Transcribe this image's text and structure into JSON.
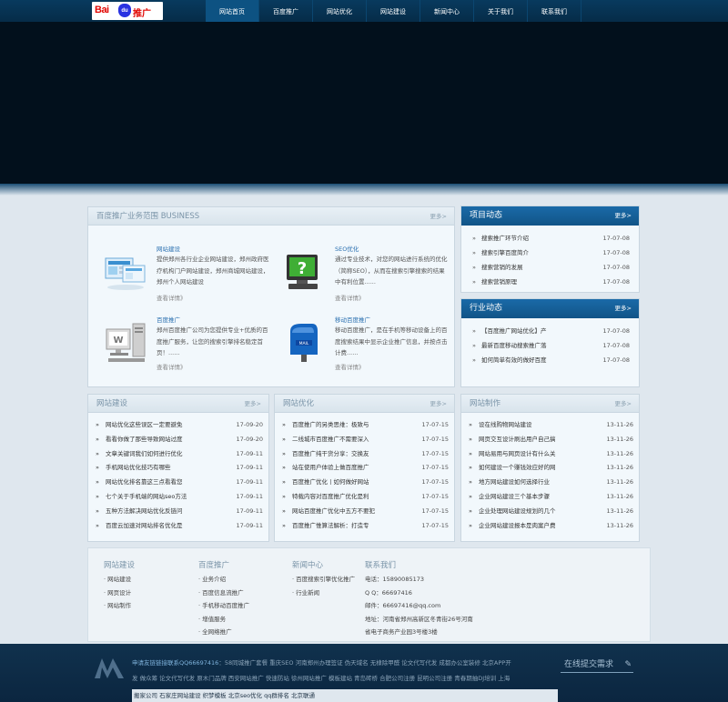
{
  "logo": {
    "bai": "Bai",
    "du": "du",
    "tg": "推广"
  },
  "nav": [
    "网站首页",
    "百度推广",
    "网站优化",
    "网站建设",
    "新闻中心",
    "关于我们",
    "联系我们"
  ],
  "business": {
    "title": "百度推广业务范围 BUSINESS",
    "more": "更多>",
    "items": [
      {
        "title": "网站建设",
        "desc": "提供郑州各行业企业网站建设，郑州政府医疗机构门户网站建设，郑州商城网站建设，郑州个人网站建设",
        "link": "查看详情》"
      },
      {
        "title": "SEO优化",
        "desc": "通过专业技术，对您的网站进行系统的优化（简称SEO），从而在搜索引擎搜索的结果中有利位置......",
        "link": "查看详情》"
      },
      {
        "title": "百度推广",
        "desc": "郑州百度推广公司为您提供专业+优质的百度推广服务，让您的搜索引擎排名稳定首页！......",
        "link": "查看详情》"
      },
      {
        "title": "移动百度推广",
        "desc": "移动百度推广，是在手机等移动设备上的百度搜索结果中显示企业推广信息，并按点击计费......",
        "link": "查看详情》"
      }
    ]
  },
  "projects": {
    "title": "项目动态",
    "more": "更多>",
    "rows": [
      {
        "b": "»",
        "t": "搜索推广环节介绍",
        "d": "17-07-08"
      },
      {
        "b": "»",
        "t": "搜索引擎百度简介",
        "d": "17-07-08"
      },
      {
        "b": "»",
        "t": "搜索营销的发展",
        "d": "17-07-08"
      },
      {
        "b": "»",
        "t": "搜索营销原理",
        "d": "17-07-08"
      }
    ]
  },
  "industry": {
    "title": "行业动态",
    "more": "更多>",
    "rows": [
      {
        "b": "»",
        "t": "【百度推广网站优化】产",
        "d": "17-07-08"
      },
      {
        "b": "»",
        "t": "最新百度移动搜索推广落",
        "d": "17-07-08"
      },
      {
        "b": "»",
        "t": "如何简单有效的做好百度",
        "d": "17-07-08"
      }
    ]
  },
  "cols": [
    {
      "title": "网站建设",
      "more": "更多>",
      "rows": [
        {
          "b": "»",
          "t": "网站优化这些误区一定要避免",
          "d": "17-09-20"
        },
        {
          "b": "»",
          "t": "看看你做了那些导致网站过度",
          "d": "17-09-20"
        },
        {
          "b": "»",
          "t": "文章关键词我们如何进行优化",
          "d": "17-09-11"
        },
        {
          "b": "»",
          "t": "手机网站优化技巧有哪些",
          "d": "17-09-11"
        },
        {
          "b": "»",
          "t": "网站优化排名靠这三点看看您",
          "d": "17-09-11"
        },
        {
          "b": "»",
          "t": "七个关于手机端的网站seo方法",
          "d": "17-09-11"
        },
        {
          "b": "»",
          "t": "五种方法解决网站优化反链问",
          "d": "17-09-11"
        },
        {
          "b": "»",
          "t": "百度云加速对网站排名优化是",
          "d": "17-09-11"
        }
      ]
    },
    {
      "title": "网站优化",
      "more": "更多>",
      "rows": [
        {
          "b": "»",
          "t": "百度推广的另类思维：极致与",
          "d": "17-07-15"
        },
        {
          "b": "»",
          "t": "二线城市百度推广不需要深入",
          "d": "17-07-15"
        },
        {
          "b": "»",
          "t": "百度推广纯干货分享：交换友",
          "d": "17-07-15"
        },
        {
          "b": "»",
          "t": "站在使用户体验上做百度推广",
          "d": "17-07-15"
        },
        {
          "b": "»",
          "t": "百度推广优化丨如何做好网站",
          "d": "17-07-15"
        },
        {
          "b": "»",
          "t": "特载内容对百度推广优化是利",
          "d": "17-07-15"
        },
        {
          "b": "»",
          "t": "网站百度推广优化中五方不要犯",
          "d": "17-07-15"
        },
        {
          "b": "»",
          "t": "百度推广惟算法解析：打造专",
          "d": "17-07-15"
        }
      ]
    },
    {
      "title": "网站制作",
      "more": "更多>",
      "rows": [
        {
          "b": "»",
          "t": "设在线购物网站建设",
          "d": "13-11-26"
        },
        {
          "b": "»",
          "t": "网页交互设计刷出用户自己搞",
          "d": "13-11-26"
        },
        {
          "b": "»",
          "t": "网站易用与网页设计有什么关",
          "d": "13-11-26"
        },
        {
          "b": "»",
          "t": "如何建设一个赚钱效应好的网",
          "d": "13-11-26"
        },
        {
          "b": "»",
          "t": "地方网站建设如何选择行业",
          "d": "13-11-26"
        },
        {
          "b": "»",
          "t": "企业网站建设三个基本步骤",
          "d": "13-11-26"
        },
        {
          "b": "»",
          "t": "企业处理网站建设规划的几个",
          "d": "13-11-26"
        },
        {
          "b": "»",
          "t": "企业网站建设报本是肉案户费",
          "d": "13-11-26"
        }
      ]
    }
  ],
  "footnav": [
    {
      "title": "网站建设",
      "items": [
        "· 网站建设",
        "· 网页设计",
        "· 网站制作"
      ]
    },
    {
      "title": "百度推广",
      "items": [
        "· 业务介绍",
        "· 百度信息流推广",
        "· 手机移动百度推广",
        "· 增值服务",
        "· 全网络推广"
      ]
    },
    {
      "title": "新闻中心",
      "items": [
        "· 百度搜索引擎优化推广",
        "· 行业新闻"
      ]
    },
    {
      "title": "联系我们",
      "items": [
        "电话：15890085173",
        "Q Q：66697416",
        "邮件：66697416@qq.com",
        "地址：河南省郑州高新区冬青街26号河南",
        "省电子商务产业园3号楼3楼"
      ]
    }
  ],
  "footer": {
    "line1a": "申请友链链接联系QQ66697416",
    "line1b": "：58同城推广套餐 重庆SEO 河南郑州办理签证 伪天域名 无棣除甲醛 论文代写代发 成都办公室装修 北京APP开",
    "line2": "发 做众筹 论文代写代发 原木门品牌 西安网站推广 快速防站 徐州网站推广 模板建站 青岛砖桥 合肥公司注册 昆明公司注册 青春期抽DJ培训 上海",
    "line3": "搬家公司 石家庄网站建设 织梦模板 北京seo优化 qq群排名 北京联通",
    "zx": "在线提交需求"
  }
}
